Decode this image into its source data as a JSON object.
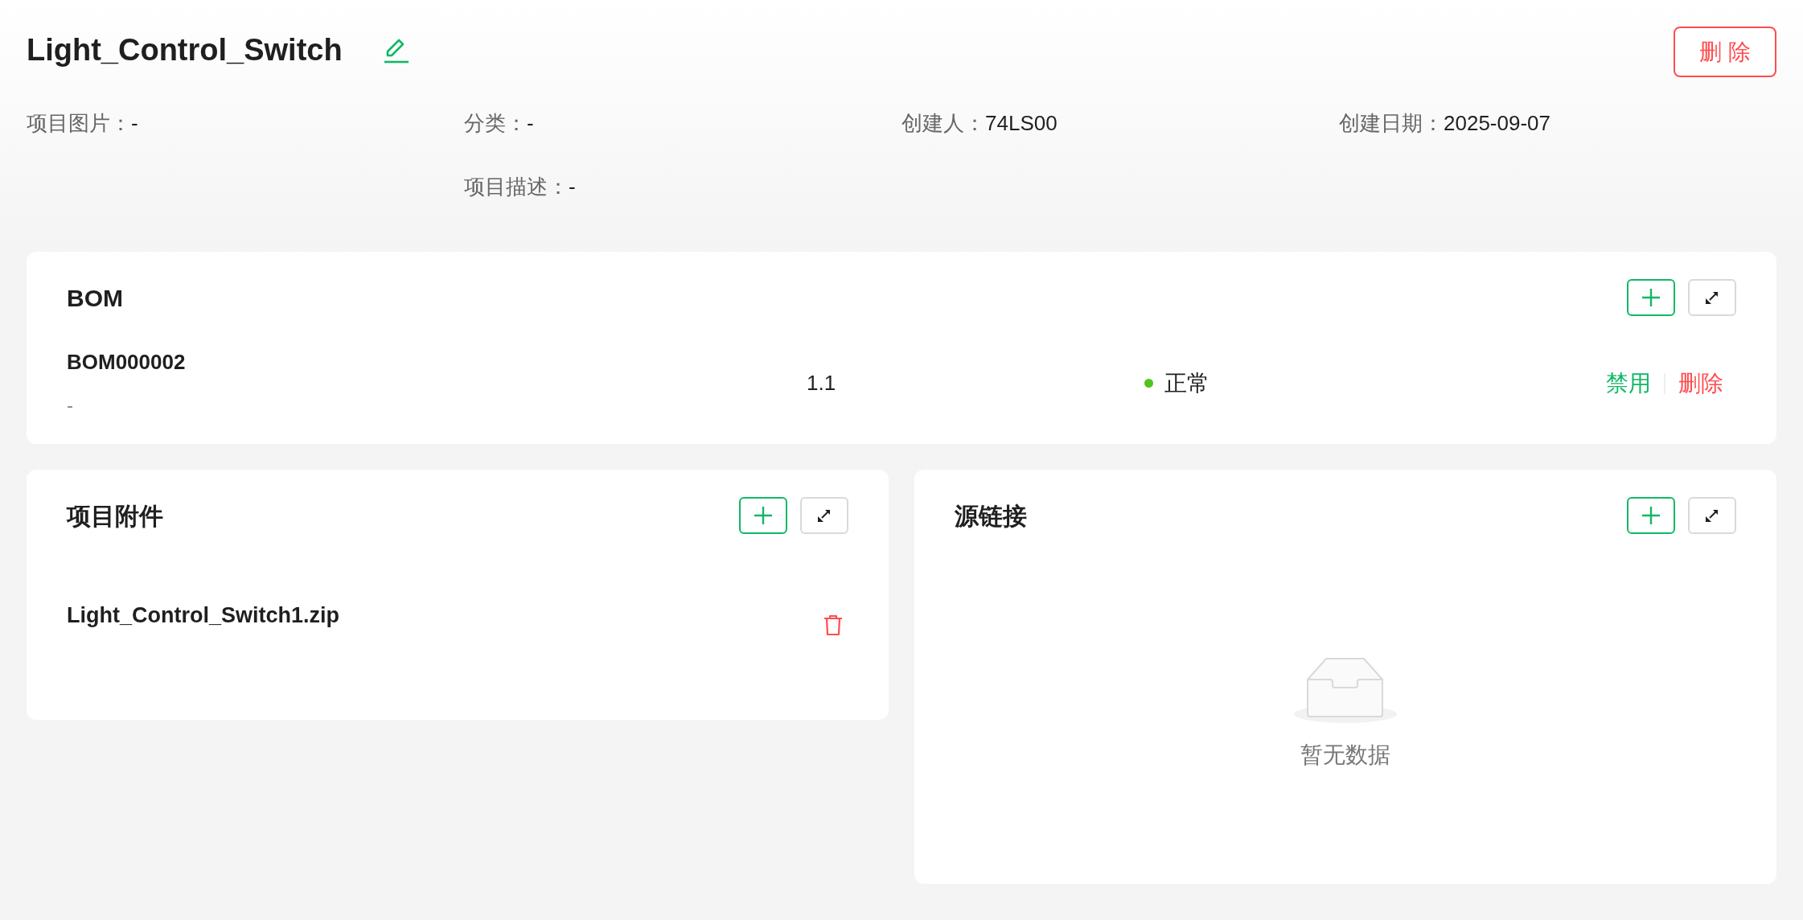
{
  "project": {
    "title": "Light_Control_Switch",
    "delete_button": "删 除",
    "fields": [
      {
        "label": "项目图片：",
        "value": "-"
      },
      {
        "label": "分类：",
        "value": "-"
      },
      {
        "label": "创建人：",
        "value": "74LS00"
      },
      {
        "label": "创建日期：",
        "value": "2025-09-07"
      },
      {
        "label": "项目描述：",
        "value": "-"
      }
    ]
  },
  "bom": {
    "title": "BOM",
    "rows": [
      {
        "code": "BOM000002",
        "description": "-",
        "version": "1.1",
        "status": "正常",
        "color": "#52c41a",
        "actions": [
          {
            "label": "禁用",
            "kind": "disable"
          },
          {
            "label": "删除",
            "kind": "delete"
          }
        ]
      }
    ]
  },
  "attachments": {
    "title": "项目附件",
    "files": [
      {
        "name": "Light_Control_Switch1.zip"
      }
    ]
  },
  "source_links": {
    "title": "源链接",
    "empty_text": "暂无数据"
  }
}
